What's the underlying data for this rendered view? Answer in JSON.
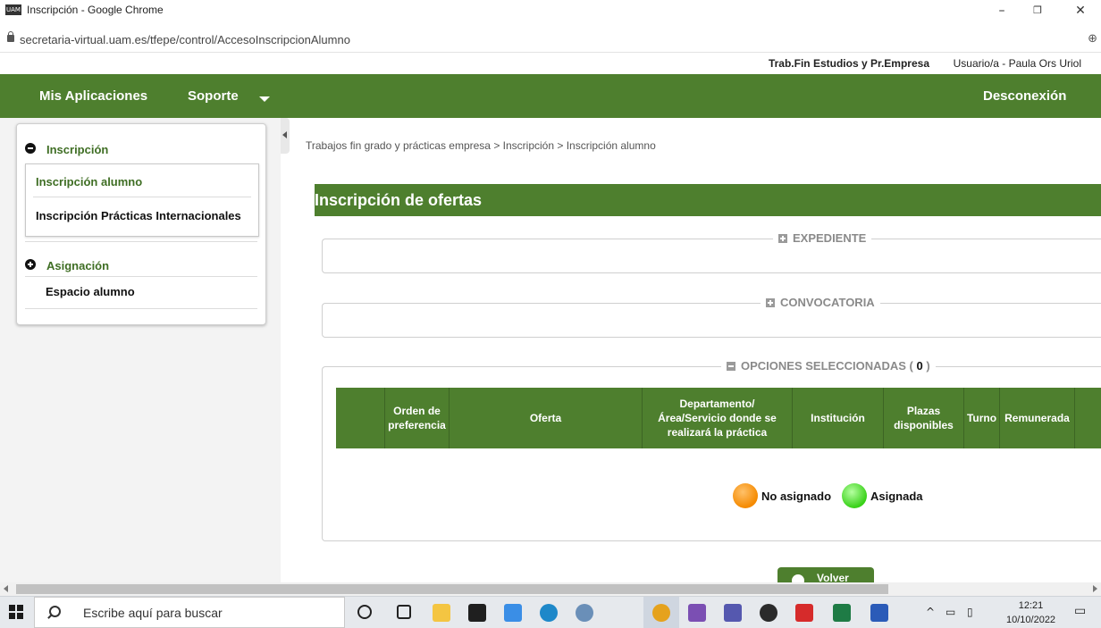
{
  "window": {
    "app_icon": "UAM",
    "title": "Inscripción - Google Chrome",
    "url": "secretaria-virtual.uam.es/tfepe/control/AccesoInscripcionAlumno"
  },
  "header": {
    "system_name": "Trab.Fin Estudios y Pr.Empresa",
    "user_label": "Usuario/a - Paula Ors Uriol"
  },
  "nav": {
    "mis_aplicaciones": "Mis Aplicaciones",
    "soporte": "Soporte",
    "desconexion": "Desconexión"
  },
  "sidebar": {
    "sections": [
      {
        "label": "Inscripción",
        "icon": "minus-circle-icon",
        "items": [
          "Inscripción alumno",
          "Inscripción Prácticas Internacionales"
        ]
      },
      {
        "label": "Asignación",
        "icon": "plus-circle-icon",
        "items": [
          "Espacio alumno"
        ]
      }
    ]
  },
  "main": {
    "breadcrumb": "Trabajos fin grado y prácticas empresa > Inscripción > Inscripción alumno",
    "title": "Inscripción de ofertas",
    "fieldsets": {
      "expediente": "EXPEDIENTE",
      "convocatoria": "CONVOCATORIA",
      "opciones": "OPCIONES SELECCIONADAS (",
      "opciones_count": "0",
      "opciones_close": ")"
    },
    "table": {
      "columns": [
        "",
        "Orden de preferencia",
        "Oferta",
        "Departamento/ Área/Servicio donde se realizará la práctica",
        "Institución",
        "Plazas disponibles",
        "Turno",
        "Remunerada",
        ""
      ],
      "rows": []
    },
    "legend": {
      "no_asignado": "No asignado",
      "asignada": "Asignada",
      "no_asignado_color": "#f58a00",
      "asignada_color": "#39d119"
    },
    "volver": "Volver"
  },
  "taskbar": {
    "search_placeholder": "Escribe aquí para buscar",
    "time": "12:21",
    "date": "10/10/2022"
  },
  "colors": {
    "brand_green": "#4e7f2e",
    "link_green": "#3f6e24"
  }
}
